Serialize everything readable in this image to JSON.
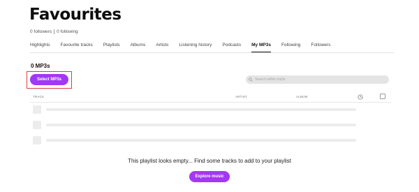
{
  "page": {
    "title": "Favourites"
  },
  "stats": {
    "followers": "0 followers",
    "following": "0 following"
  },
  "tabs": [
    {
      "label": "Highlights",
      "active": false
    },
    {
      "label": "Favourite tracks",
      "active": false
    },
    {
      "label": "Playlists",
      "active": false
    },
    {
      "label": "Albums",
      "active": false
    },
    {
      "label": "Artists",
      "active": false
    },
    {
      "label": "Listening history",
      "active": false
    },
    {
      "label": "Podcasts",
      "active": false
    },
    {
      "label": "My MP3s",
      "active": true
    },
    {
      "label": "Following",
      "active": false
    },
    {
      "label": "Followers",
      "active": false
    }
  ],
  "section": {
    "count_label": "0 MP3s",
    "select_button": "Select MP3s"
  },
  "search": {
    "placeholder": "Search within mp3s",
    "icon": "search-icon"
  },
  "table": {
    "headers": {
      "track": "TRACK",
      "artist": "ARTIST",
      "album": "ALBUM"
    },
    "duration_icon": "clock-icon"
  },
  "empty_state": {
    "message": "This playlist looks empty... Find some tracks to add to your playlist",
    "button": "Explore music"
  },
  "colors": {
    "accent": "#a238f5",
    "highlight_border": "#e23b3b",
    "skeleton": "#ececec"
  }
}
